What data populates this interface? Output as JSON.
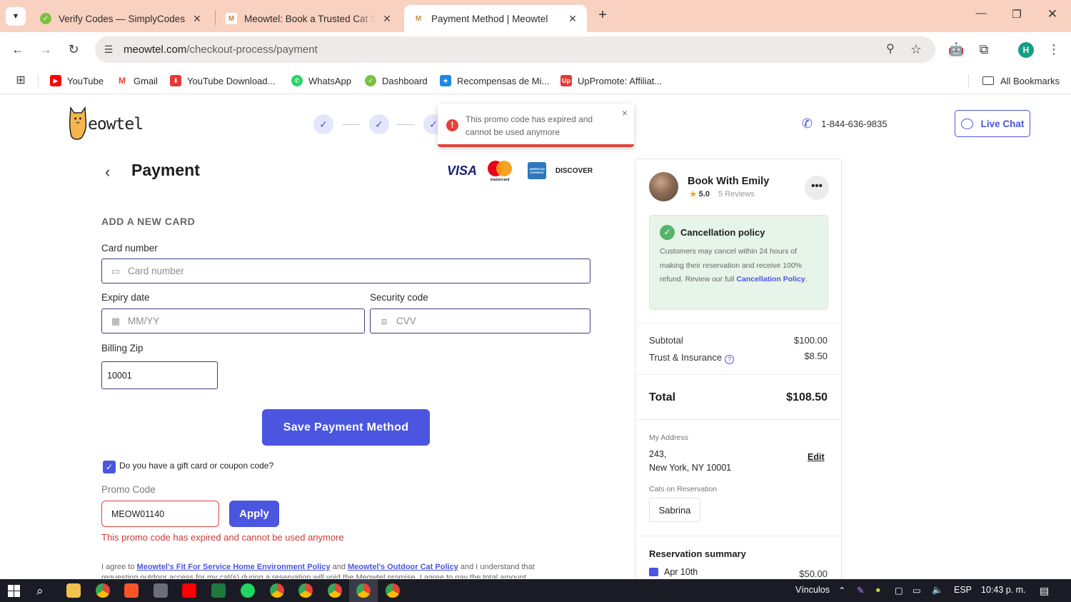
{
  "browser": {
    "tabs": [
      {
        "title": "Verify Codes — SimplyCodes",
        "favicon": "simplycodes-icon"
      },
      {
        "title": "Meowtel: Book a Trusted Cat Sit",
        "favicon": "meowtel-icon"
      },
      {
        "title": "Payment Method | Meowtel",
        "favicon": "meowtel-icon",
        "active": true
      }
    ],
    "url_host": "meowtel.com",
    "url_path": "/checkout-process/payment",
    "profile_initial": "H",
    "bookmarks": [
      {
        "label": "YouTube",
        "icon": "youtube-icon",
        "color": "#ff0000"
      },
      {
        "label": "Gmail",
        "icon": "gmail-icon",
        "color": "#ea4335"
      },
      {
        "label": "YouTube Download...",
        "icon": "download-icon",
        "color": "#e53935"
      },
      {
        "label": "WhatsApp",
        "icon": "whatsapp-icon",
        "color": "#25d366"
      },
      {
        "label": "Dashboard",
        "icon": "dashboard-icon",
        "color": "#43a047"
      },
      {
        "label": "Recompensas de Mi...",
        "icon": "rewards-icon",
        "color": "#1e88e5"
      },
      {
        "label": "UpPromote: Affiliat...",
        "icon": "uppromote-icon",
        "color": "#e53935"
      }
    ],
    "all_bookmarks": "All Bookmarks"
  },
  "header": {
    "logo_text": "eowtel",
    "phone": "1-844-636-9835",
    "live_chat": "Live Chat"
  },
  "toast": {
    "message": "This promo code has expired and cannot be used anymore",
    "close": "×"
  },
  "payment": {
    "title": "Payment",
    "back": "‹",
    "card_brands": [
      "VISA",
      "mastercard",
      "AMERICAN EXPRESS",
      "DISCOVER"
    ],
    "section_label": "ADD A NEW CARD",
    "card_number_label": "Card number",
    "card_number_placeholder": "Card number",
    "expiry_label": "Expiry date",
    "expiry_placeholder": "MM/YY",
    "security_label": "Security code",
    "security_placeholder": "CVV",
    "zip_label": "Billing Zip",
    "zip_value": "10001",
    "save_button": "Save Payment Method",
    "gift_checkbox_label": "Do you have a gift card or coupon code?",
    "promo_label": "Promo Code",
    "promo_value": "MEOW01140",
    "apply_button": "Apply",
    "promo_error": "This promo code has expired and cannot be used anymore",
    "agree_prefix": "I agree to",
    "agree_link1": "Meowtel's Fit For Service Home Environment Policy",
    "agree_and": "and",
    "agree_link2": "Meowtel's Outdoor Cat Policy",
    "agree_suffix": "and I understand that requesting outdoor access for my cat(s) during a reservation will void the Meowtel promise. I agree to pay the total amount"
  },
  "summary": {
    "sitter_name": "Book With Emily",
    "rating": "5.0",
    "reviews": "5 Reviews",
    "more": "•••",
    "policy_title": "Cancellation policy",
    "policy_body": "Customers may cancel within 24 hours of making their reservation and receive 100% refund. Review our full",
    "policy_link": "Cancellation Policy",
    "policy_end": ".",
    "subtotal_label": "Subtotal",
    "subtotal_value": "$100.00",
    "trust_label": "Trust & Insurance",
    "trust_value": "$8.50",
    "total_label": "Total",
    "total_value": "$108.50",
    "address_label": "My Address",
    "address_line1": "243,",
    "address_line2": "New York, NY 10001",
    "edit": "Edit",
    "cats_label": "Cats on Reservation",
    "cat_name": "Sabrina",
    "reservation_title": "Reservation summary",
    "reservation_date": "Apr 10th",
    "reservation_price": "$50.00"
  },
  "taskbar": {
    "vinculos": "Vínculos",
    "lang": "ESP",
    "time": "10:43 p. m."
  },
  "colors": {
    "accent": "#4a55e0",
    "error": "#e2433c",
    "tabbar": "#f9d1c1",
    "policy_bg": "#e7f4e9"
  }
}
